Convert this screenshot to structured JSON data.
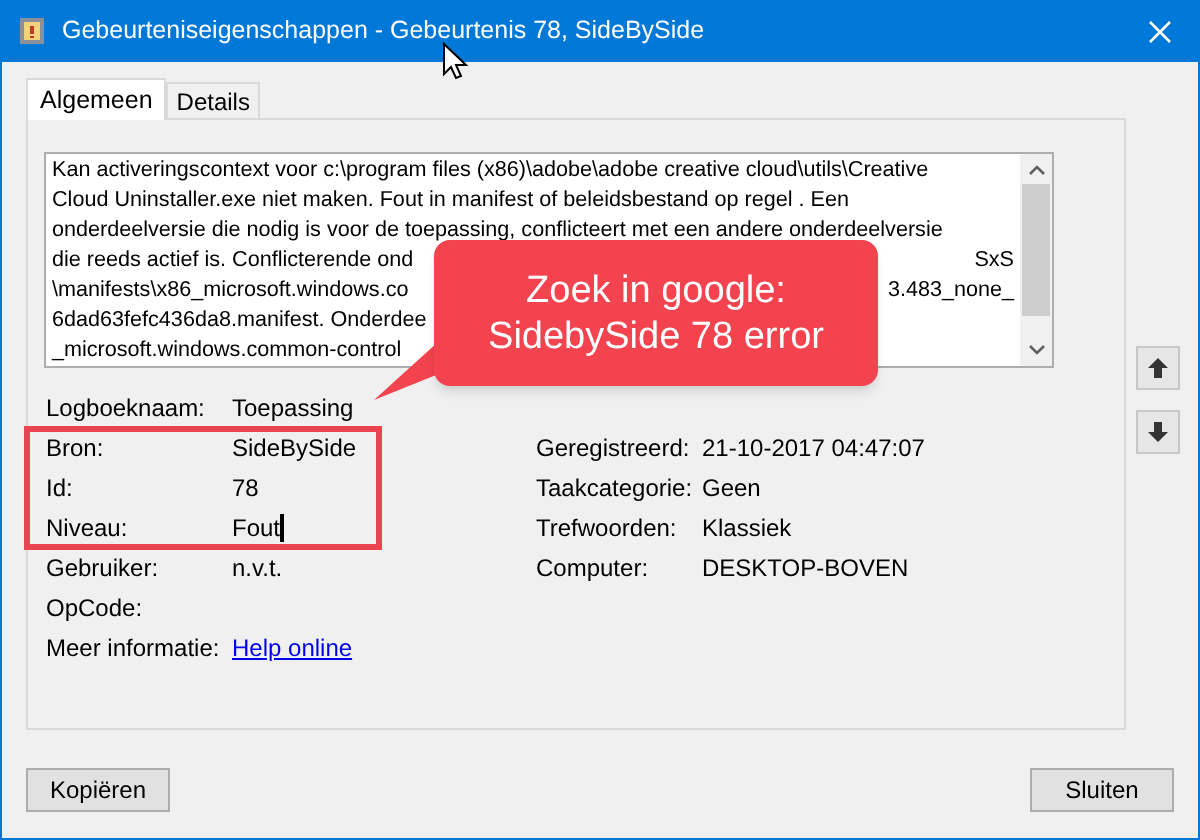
{
  "window": {
    "title": "Gebeurteniseigenschappen - Gebeurtenis 78, SideBySide"
  },
  "tabs": [
    {
      "label": "Algemeen",
      "selected": true
    },
    {
      "label": "Details",
      "selected": false
    }
  ],
  "description": {
    "lines": [
      {
        "text": "Kan activeringscontext voor c:\\program files (x86)\\adobe\\adobe creative cloud\\utils\\Creative"
      },
      {
        "text": "Cloud Uninstaller.exe niet maken. Fout in manifest of beleidsbestand  op regel . Een"
      },
      {
        "text": "onderdeelversie die nodig is voor de toepassing, conflicteert met een andere onderdeelversie"
      },
      {
        "text": "die reeds actief is. Conflicterende ond",
        "text_right": "SxS"
      },
      {
        "text": "\\manifests\\x86_microsoft.windows.co",
        "text_right": "3.483_none_"
      },
      {
        "text": "6dad63fefc436da8.manifest. Onderdee"
      },
      {
        "text": "_microsoft.windows.common-control"
      }
    ]
  },
  "fields": [
    {
      "label": "Logboeknaam:",
      "value": "Toepassing"
    },
    {
      "label": "Bron:",
      "value": "SideBySide",
      "label_2": "Geregistreerd:",
      "value_2": "21-10-2017 04:47:07"
    },
    {
      "label": "Id:",
      "value": "78",
      "label_2": "Taakcategorie:",
      "value_2": "Geen"
    },
    {
      "label": "Niveau:",
      "value": "Fout",
      "label_2": "Trefwoorden:",
      "value_2": "Klassiek",
      "caret": true
    },
    {
      "label": "Gebruiker:",
      "value": "n.v.t.",
      "label_2": "Computer:",
      "value_2": "DESKTOP-BOVEN"
    },
    {
      "label": "OpCode:"
    },
    {
      "label": "Meer informatie:",
      "value": "Help online",
      "kind": "link"
    }
  ],
  "callout": {
    "lines": [
      "Zoek in google:",
      "SidebySide 78 error"
    ]
  },
  "buttons": [
    "Kopiëren",
    "Sluiten"
  ]
}
